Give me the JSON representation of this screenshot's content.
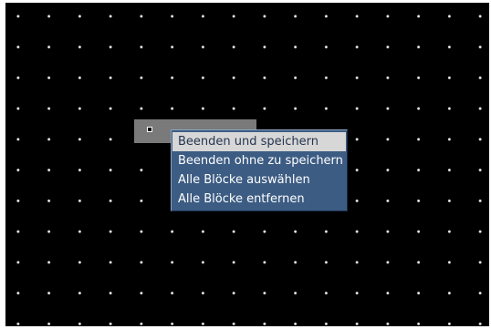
{
  "colors": {
    "canvas_background": "#000000",
    "grid_dot": "#e6e6e6",
    "block_fill": "#7a7a7a",
    "menu_background": "#3c5c83",
    "menu_text": "#ffffff",
    "menu_highlight_background": "#d7d7d7",
    "menu_highlight_text": "#26354f"
  },
  "context_menu": {
    "items": [
      {
        "label": "Beenden und speichern",
        "highlighted": true
      },
      {
        "label": "Beenden ohne zu speichern",
        "highlighted": false
      },
      {
        "label": "Alle Blöcke auswählen",
        "highlighted": false
      },
      {
        "label": "Alle Blöcke entfernen",
        "highlighted": false
      }
    ]
  }
}
